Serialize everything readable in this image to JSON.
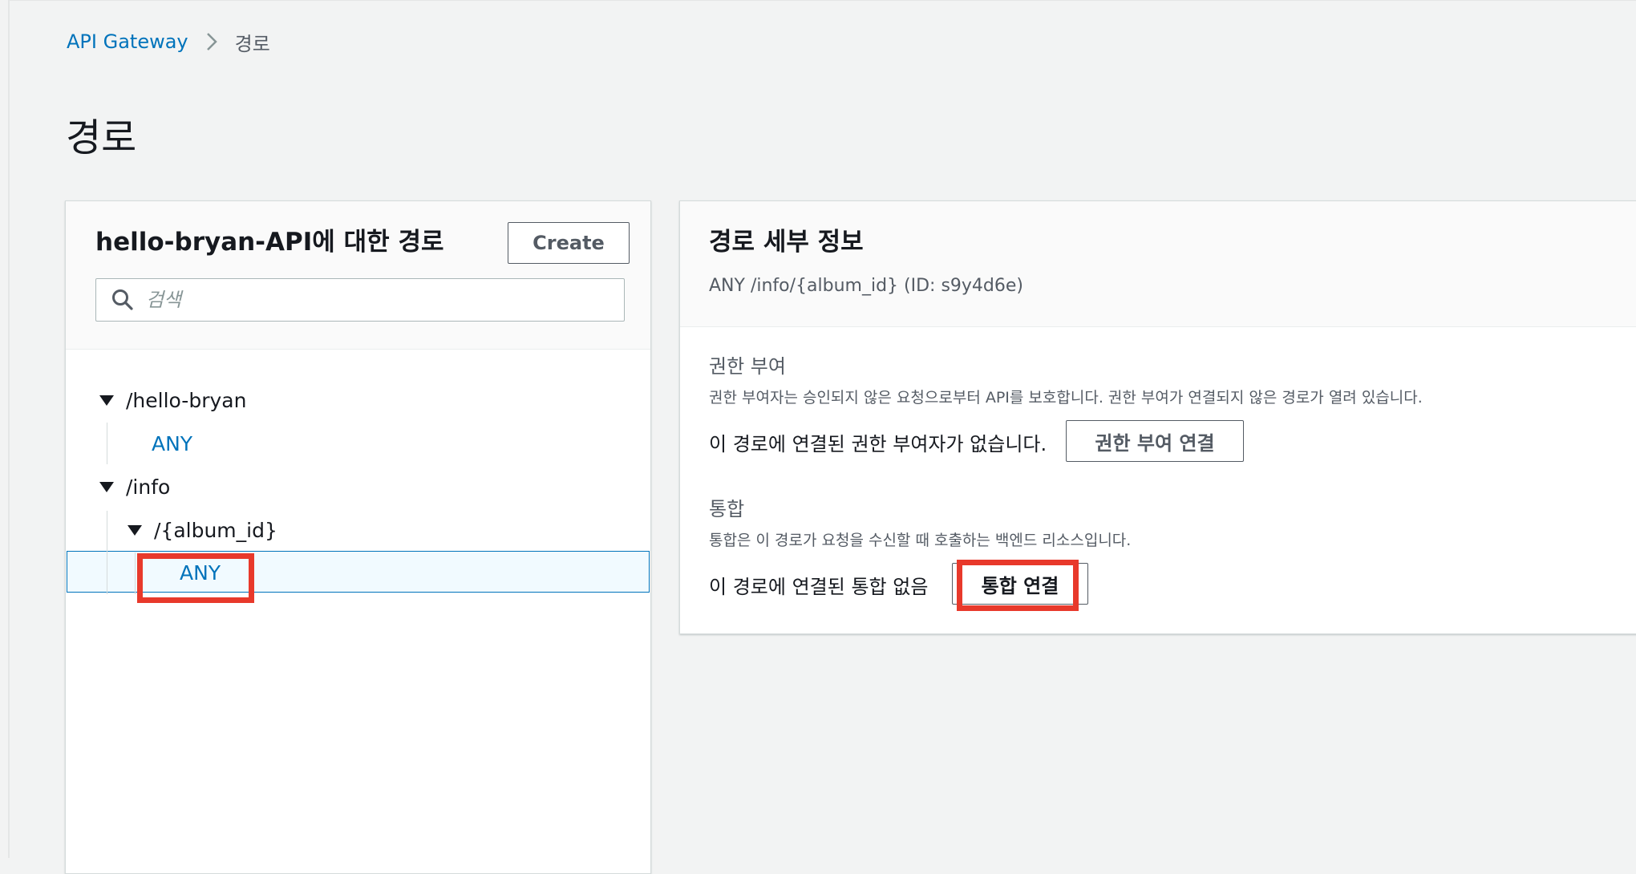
{
  "breadcrumb": {
    "root": "API Gateway",
    "current": "경로"
  },
  "page": {
    "title": "경로"
  },
  "routes_panel": {
    "title": "hello-bryan-API에 대한 경로",
    "create_label": "Create",
    "search_placeholder": "검색",
    "tree": [
      {
        "path": "/hello-bryan",
        "method": "ANY"
      },
      {
        "path": "/info",
        "child_path": "/{album_id}",
        "method": "ANY",
        "selected": true
      }
    ]
  },
  "details_panel": {
    "title": "경로 세부 정보",
    "subtitle": "ANY /info/{album_id} (ID: s9y4d6e)",
    "authorization": {
      "label": "권한 부여",
      "description": "권한 부여자는 승인되지 않은 요청으로부터 API를 보호합니다. 권한 부여가 연결되지 않은 경로가 열려 있습니다.",
      "status": "이 경로에 연결된 권한 부여자가 없습니다.",
      "button_label": "권한 부여 연결"
    },
    "integration": {
      "label": "통합",
      "description": "통합은 이 경로가 요청을 수신할 때 호출하는 백엔드 리소스입니다.",
      "status": "이 경로에 연결된 통합 없음",
      "button_label": "통합 연결"
    }
  },
  "colors": {
    "link": "#0073bb",
    "highlight": "#e8392b",
    "selected_bg": "#f1faff"
  }
}
